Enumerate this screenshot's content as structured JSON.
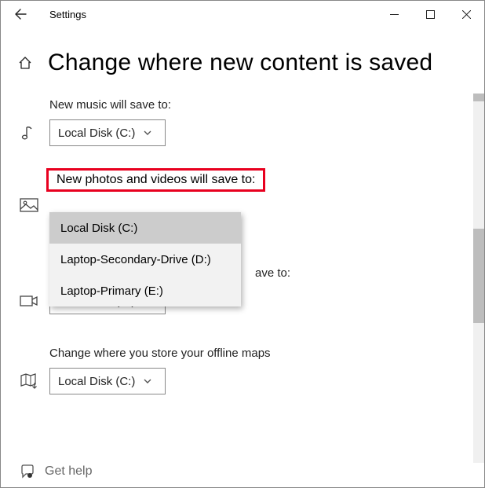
{
  "window": {
    "app_title": "Settings"
  },
  "page": {
    "title": "Change where new content is saved"
  },
  "sections": {
    "music": {
      "label": "New music will save to:",
      "value": "Local Disk (C:)"
    },
    "photos": {
      "label": "New photos and videos will save to:",
      "options": [
        "Local Disk (C:)",
        "Laptop-Secondary-Drive (D:)",
        "Laptop-Primary (E:)"
      ]
    },
    "movies": {
      "label_tail": "ave to:",
      "value": "Local Disk (C:)"
    },
    "maps": {
      "label": "Change where you store your offline maps",
      "value": "Local Disk (C:)"
    }
  },
  "footer": {
    "help": "Get help"
  }
}
